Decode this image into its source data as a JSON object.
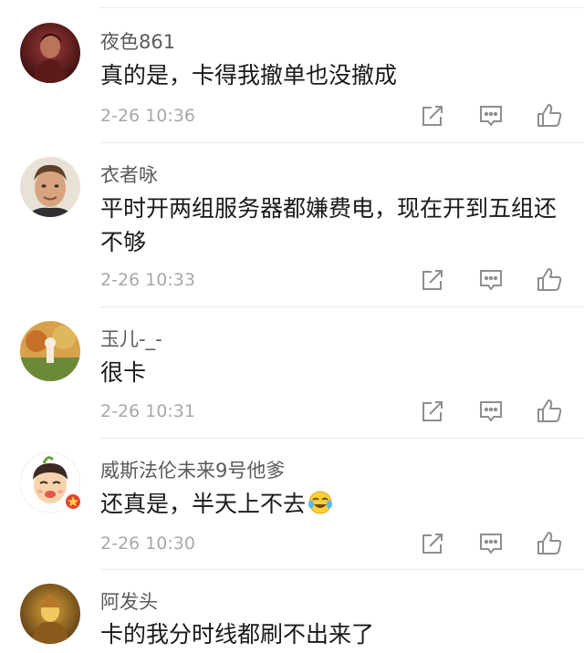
{
  "colors": {
    "background": "#ffffff",
    "username": "#5a5a5a",
    "text": "#1a1a1a",
    "timestamp": "#a8a8a8",
    "icon": "#8e8e8e",
    "divider": "#e9e9e9"
  },
  "comments": [
    {
      "username": "夜色861",
      "text": "真的是，卡得我撤单也没撤成",
      "time": "2-26 10:36",
      "avatar": "dark-red-silhouette-avatar"
    },
    {
      "username": "衣者咏",
      "text": "平时开两组服务器都嫌费电，现在开到五组还不够",
      "time": "2-26 10:33",
      "avatar": "man-portrait-avatar"
    },
    {
      "username": "玉儿-_-",
      "text": "很卡",
      "time": "2-26 10:31",
      "avatar": "autumn-scene-avatar"
    },
    {
      "username": "威斯法伦未来9号他爹",
      "text": "还真是，半天上不去",
      "emoji": "cry-laugh-emoji",
      "time": "2-26 10:30",
      "avatar": "cartoon-boy-avatar"
    },
    {
      "username": "阿发头",
      "text": "卡的我分时线都刷不出来了",
      "avatar": "golden-figure-avatar"
    }
  ],
  "actions": [
    "share-icon",
    "comment-icon",
    "like-icon"
  ]
}
